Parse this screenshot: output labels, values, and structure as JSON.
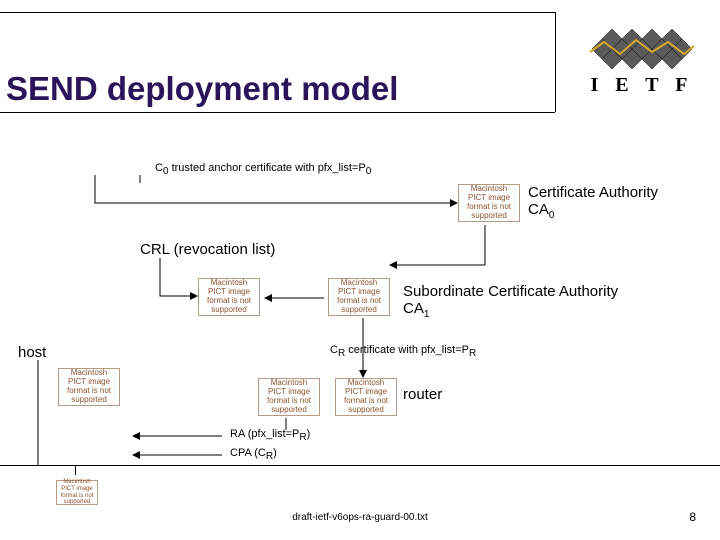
{
  "title": "SEND deployment model",
  "logo_label": "I E T F",
  "pict_placeholder": "Macintosh PICT image format is not supported",
  "labels": {
    "c0_line": "C",
    "c0_sub": "0",
    "c0_rest": " trusted anchor certificate with pfx_list=P",
    "p0_sub": "0",
    "ca0_a": "Certificate Authority",
    "ca0_b": "CA",
    "ca0_sub": "0",
    "crl": "CRL (revocation list)",
    "sub_ca_a": "Subordinate Certificate Authority",
    "sub_ca_b": "CA",
    "sub_ca_sub": "1",
    "cr_line_a": "C",
    "cr_sub": "R",
    "cr_rest": " certificate with pfx_list=P",
    "pr_sub": "R",
    "host": "host",
    "router": "router",
    "ra_a": "RA (pfx_list=P",
    "ra_sub": "R",
    "ra_b": ")",
    "cpa_a": "CPA (C",
    "cpa_sub": "R",
    "cpa_b": ")"
  },
  "footer": "draft-ietf-v6ops-ra-guard-00.txt",
  "page": "8"
}
